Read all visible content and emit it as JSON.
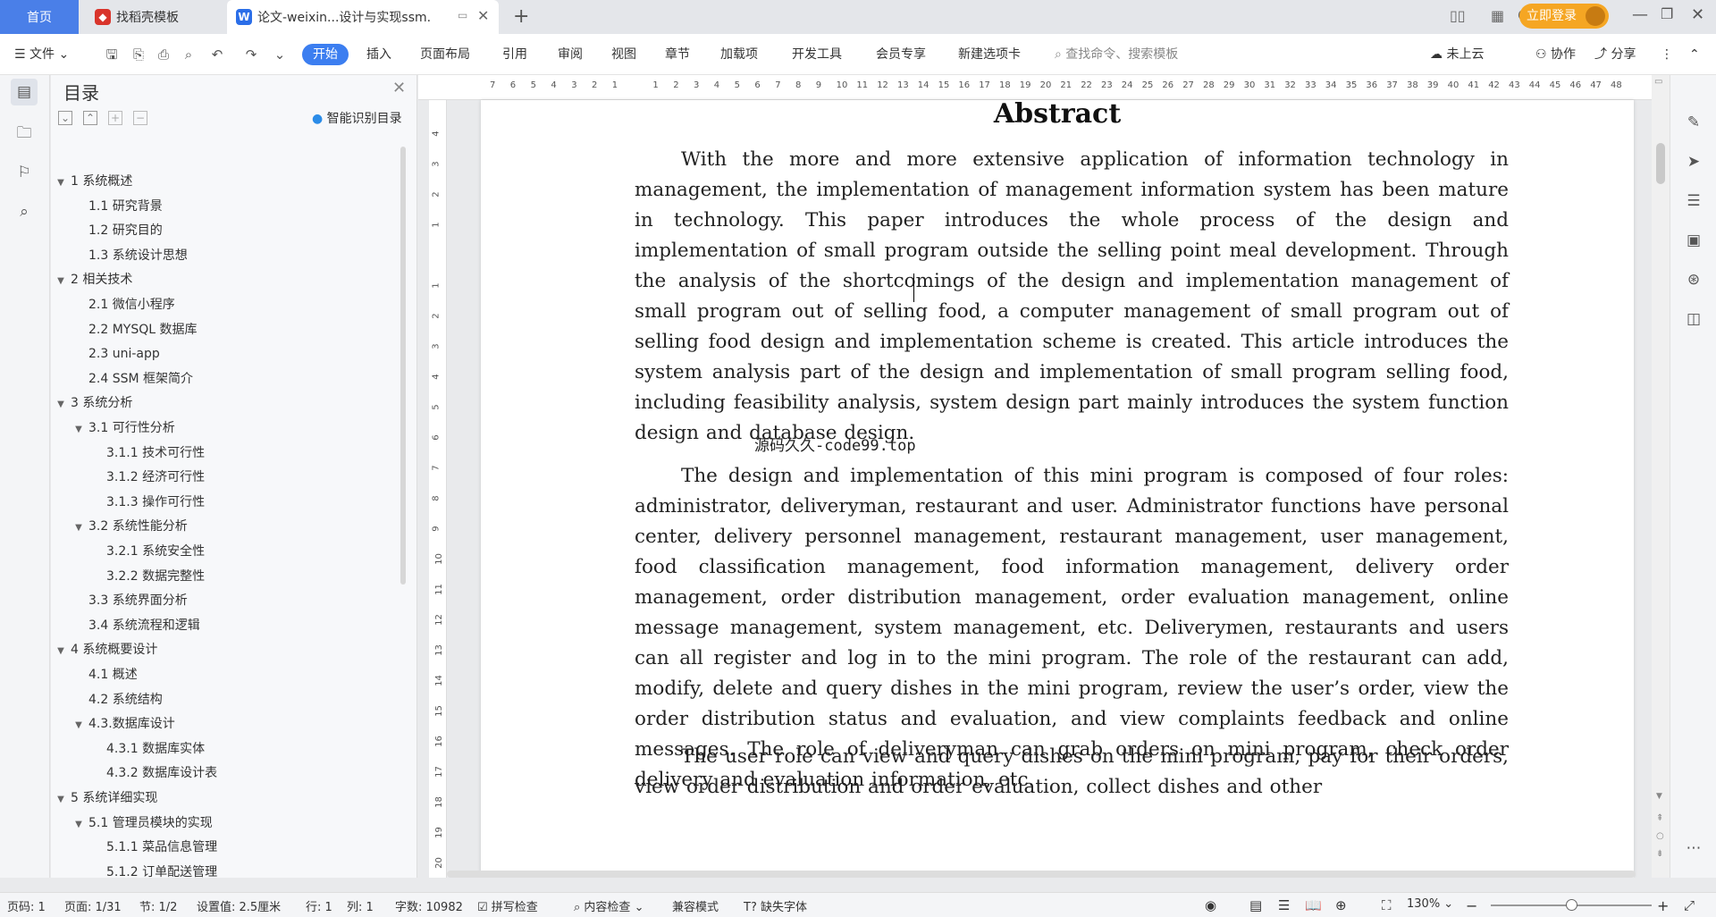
{
  "tabs": {
    "home": "首页",
    "doc2": "找稻壳模板",
    "doc3": "论文-weixin...设计与实现ssm."
  },
  "titlebar": {
    "login": "立即登录"
  },
  "toolbar": {
    "file": "文件",
    "menus": [
      "开始",
      "插入",
      "页面布局",
      "引用",
      "审阅",
      "视图",
      "章节",
      "加载项",
      "开发工具",
      "会员专享",
      "新建选项卡"
    ],
    "search_placeholder": "查找命令、搜索模板",
    "cloud": "未上云",
    "collab": "协作",
    "share": "分享"
  },
  "toc": {
    "title": "目录",
    "smart": "智能识别目录",
    "items": [
      {
        "label": "1 系统概述",
        "level": 0,
        "caret": "v"
      },
      {
        "label": "1.1  研究背景",
        "level": 1,
        "caret": ""
      },
      {
        "label": "1.2 研究目的",
        "level": 1,
        "caret": ""
      },
      {
        "label": "1.3 系统设计思想",
        "level": 1,
        "caret": ""
      },
      {
        "label": "2 相关技术",
        "level": 0,
        "caret": "v"
      },
      {
        "label": "2.1 微信小程序",
        "level": 1,
        "caret": ""
      },
      {
        "label": "2.2 MYSQL 数据库",
        "level": 1,
        "caret": ""
      },
      {
        "label": "2.3 uni-app",
        "level": 1,
        "caret": ""
      },
      {
        "label": "2.4 SSM 框架简介",
        "level": 1,
        "caret": ""
      },
      {
        "label": "3 系统分析",
        "level": 0,
        "caret": "v"
      },
      {
        "label": "3.1 可行性分析",
        "level": 1,
        "caret": "v"
      },
      {
        "label": "3.1.1 技术可行性",
        "level": 2,
        "caret": ""
      },
      {
        "label": "3.1.2 经济可行性",
        "level": 2,
        "caret": ""
      },
      {
        "label": "3.1.3 操作可行性",
        "level": 2,
        "caret": ""
      },
      {
        "label": "3.2 系统性能分析",
        "level": 1,
        "caret": "v"
      },
      {
        "label": "3.2.1  系统安全性",
        "level": 2,
        "caret": ""
      },
      {
        "label": "3.2.2  数据完整性",
        "level": 2,
        "caret": ""
      },
      {
        "label": "3.3 系统界面分析",
        "level": 1,
        "caret": ""
      },
      {
        "label": "3.4 系统流程和逻辑",
        "level": 1,
        "caret": ""
      },
      {
        "label": "4 系统概要设计",
        "level": 0,
        "caret": "v"
      },
      {
        "label": "4.1 概述",
        "level": 1,
        "caret": ""
      },
      {
        "label": "4.2 系统结构",
        "level": 1,
        "caret": ""
      },
      {
        "label": "4.3.数据库设计",
        "level": 1,
        "caret": "v"
      },
      {
        "label": "4.3.1 数据库实体",
        "level": 2,
        "caret": ""
      },
      {
        "label": "4.3.2 数据库设计表",
        "level": 2,
        "caret": ""
      },
      {
        "label": "5 系统详细实现",
        "level": 0,
        "caret": "v"
      },
      {
        "label": "5.1  管理员模块的实现",
        "level": 1,
        "caret": "v"
      },
      {
        "label": "5.1.1  菜品信息管理",
        "level": 2,
        "caret": ""
      },
      {
        "label": "5.1.2  订单配送管理",
        "level": 2,
        "caret": ""
      }
    ]
  },
  "ruler": {
    "h": [
      "7",
      "6",
      "5",
      "4",
      "3",
      "2",
      "1",
      "",
      "1",
      "2",
      "3",
      "4",
      "5",
      "6",
      "7",
      "8",
      "9",
      "10",
      "11",
      "12",
      "13",
      "14",
      "15",
      "16",
      "17",
      "18",
      "19",
      "20",
      "21",
      "22",
      "23",
      "24",
      "25",
      "26",
      "27",
      "28",
      "29",
      "30",
      "31",
      "32",
      "33",
      "34",
      "35",
      "36",
      "37",
      "38",
      "39",
      "40",
      "41",
      "42",
      "43",
      "44",
      "45",
      "46",
      "47",
      "48"
    ],
    "v": [
      "4",
      "3",
      "2",
      "1",
      "",
      "1",
      "2",
      "3",
      "4",
      "5",
      "6",
      "7",
      "8",
      "9",
      "10",
      "11",
      "12",
      "13",
      "14",
      "15",
      "16",
      "17",
      "18",
      "19",
      "20"
    ]
  },
  "doc": {
    "heading": "Abstract",
    "p1": "With the more and more extensive application of information technology in management, the implementation of management information system has been mature in technology. This paper introduces the whole process of the design and implementation of small program outside the selling point meal development. Through the analysis of the shortcomings of the design and implementation management of small program out of selling food, a computer management of small program out of selling food design and implementation scheme is created. This article introduces the system analysis part of the design and implementation of small program selling food, including feasibility analysis, system design part mainly introduces the system function design and database design.",
    "watermark": "源码久久-code99.top",
    "p2": "The design and implementation of this mini program is composed of four roles: administrator, deliveryman, restaurant and user. Administrator functions have personal center, delivery personnel management, restaurant management, user management, food classification management, food information management, delivery order management, order distribution management, order evaluation management, online message management, system management, etc. Deliverymen, restaurants and users can all register and log in to the mini program. The role of the restaurant can add, modify, delete and query dishes in the mini program, review the user’s order, view the order distribution status and evaluation, and view complaints feedback and online messages. The role of deliveryman can grab orders on mini program, check order delivery and evaluation information, etc.",
    "p3": "The user role can view and query dishes on the mini program, pay for their orders, view order distribution and order evaluation, collect dishes and other"
  },
  "status": {
    "page_code": "页码: 1",
    "page": "页面: 1/31",
    "section": "节: 1/2",
    "setting": "设置值: 2.5厘米",
    "row": "行: 1",
    "col": "列: 1",
    "words": "字数: 10982",
    "spell": "拼写检查",
    "content": "内容检查",
    "compat": "兼容模式",
    "font_missing": "缺失字体",
    "zoom": "130%"
  },
  "colors": {
    "accent": "#3c7ef0",
    "login": "#f5a623"
  }
}
